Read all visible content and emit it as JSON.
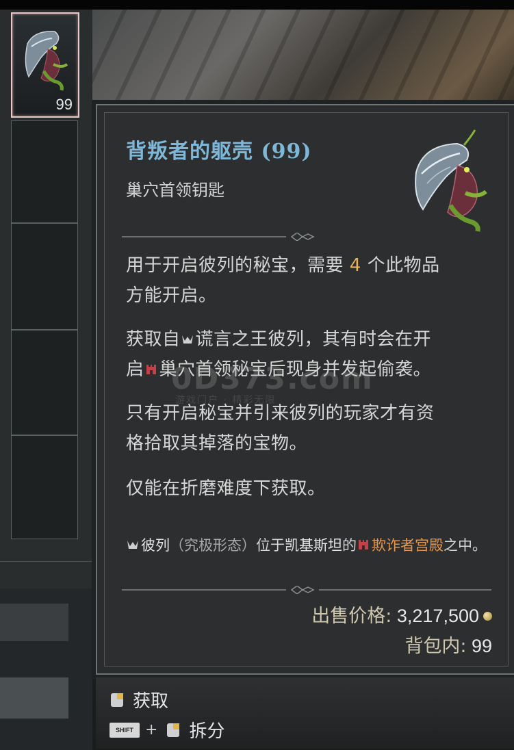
{
  "inventory": {
    "selected_slot_count": "99"
  },
  "tooltip": {
    "title": "背叛者的躯壳 (99)",
    "item_type": "巢穴首领钥匙",
    "desc1_a": "用于开启彼列的秘宝，需要 ",
    "desc1_num": "4",
    "desc1_b": " 个此物品",
    "desc1_line2": "方能开启。",
    "desc2_a": "获取自",
    "desc2_boss": "谎言之王彼列",
    "desc2_b": "，其有时会在开",
    "desc2_c": "启",
    "desc2_place": "巢穴首领秘宝",
    "desc2_d": "后现身并发起偷袭。",
    "desc3_line1": "只有开启秘宝并引来彼列的玩家才有资",
    "desc3_line2": "格拾取其掉落的宝物。",
    "desc4": "仅能在折磨难度下获取。",
    "boss_line": {
      "boss": "彼列",
      "form": "（究极形态）",
      "located": "位于",
      "region": "凯基斯坦",
      "of": "的",
      "location": "欺诈者宫殿",
      "suffix": "之中。"
    },
    "price_label": "出售价格:",
    "price_value": "3,217,500",
    "bag_label": "背包内:",
    "bag_value": "99"
  },
  "actions": {
    "obtain_label": "获取",
    "shift_key": "SHIFT",
    "plus": "+",
    "salvage_label": "拆分"
  },
  "watermark": {
    "main": "0D373.com",
    "sub": "游戏门户 · 精彩无限"
  },
  "colors": {
    "title": "#7fb7d8",
    "highlight_number": "#e5b25c",
    "location": "#e7964a"
  }
}
